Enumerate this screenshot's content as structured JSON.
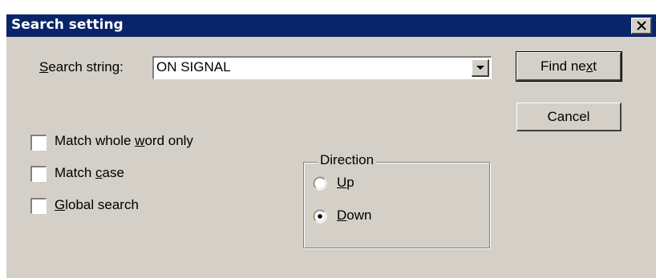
{
  "dialog": {
    "title": "Search setting",
    "close_icon": "close-x-icon"
  },
  "search": {
    "label_prefix": "",
    "label_mnemonic": "S",
    "label_rest": "earch string:",
    "value": "ON SIGNAL",
    "dropdown_icon": "chevron-down-icon"
  },
  "buttons": {
    "find_next_pre": "Find ne",
    "find_next_mnemonic": "x",
    "find_next_post": "t",
    "cancel": "Cancel"
  },
  "options": {
    "whole_word": {
      "pre": "Match whole ",
      "mnemonic": "w",
      "post": "ord only",
      "checked": false
    },
    "match_case": {
      "pre": "Match ",
      "mnemonic": "c",
      "post": "ase",
      "checked": false
    },
    "global_search": {
      "pre": "",
      "mnemonic": "G",
      "post": "lobal search",
      "checked": false
    }
  },
  "direction": {
    "legend": "Direction",
    "up": {
      "pre": "",
      "mnemonic": "U",
      "post": "p",
      "selected": false
    },
    "down": {
      "pre": "",
      "mnemonic": "D",
      "post": "own",
      "selected": true
    }
  },
  "colors": {
    "titlebar": "#0a246a",
    "face": "#d4d0c8"
  }
}
